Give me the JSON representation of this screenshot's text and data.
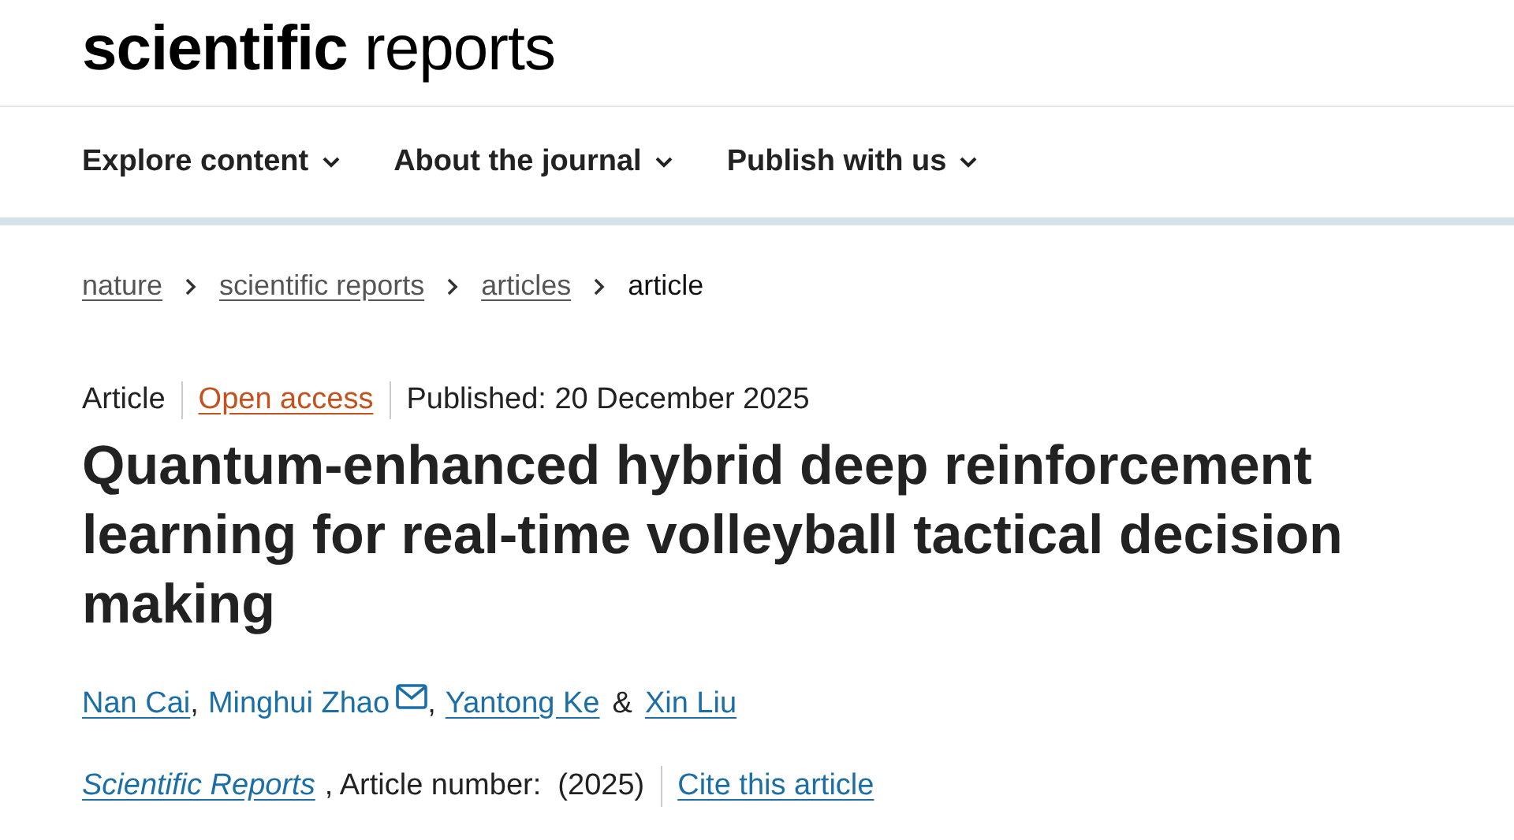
{
  "logo": "**scientific** reports",
  "nav": [
    {
      "label": "Explore content"
    },
    {
      "label": "About the journal"
    },
    {
      "label": "Publish with us"
    }
  ],
  "breadcrumbs": [
    {
      "label": "nature",
      "current": false
    },
    {
      "label": "scientific reports",
      "current": false
    },
    {
      "label": "articles",
      "current": false
    },
    {
      "label": "article",
      "current": true
    }
  ],
  "article": {
    "type": "Article",
    "access": "Open access",
    "published": "Published: 20 December 2025",
    "title": "Quantum-enhanced hybrid deep reinforcement learning for real-time volleyball tactical decision making",
    "authors": [
      {
        "name": "Nan Cai",
        "email": false,
        "separator": ","
      },
      {
        "name": "Minghui Zhao",
        "email": true,
        "separator": ","
      },
      {
        "name": "Yantong Ke",
        "email": false,
        "separator": "&"
      },
      {
        "name": "Xin Liu",
        "email": false
      }
    ],
    "journal": "Scientific Reports",
    "article_number": ", Article number:  (2025)",
    "cite": "Cite this article"
  }
}
